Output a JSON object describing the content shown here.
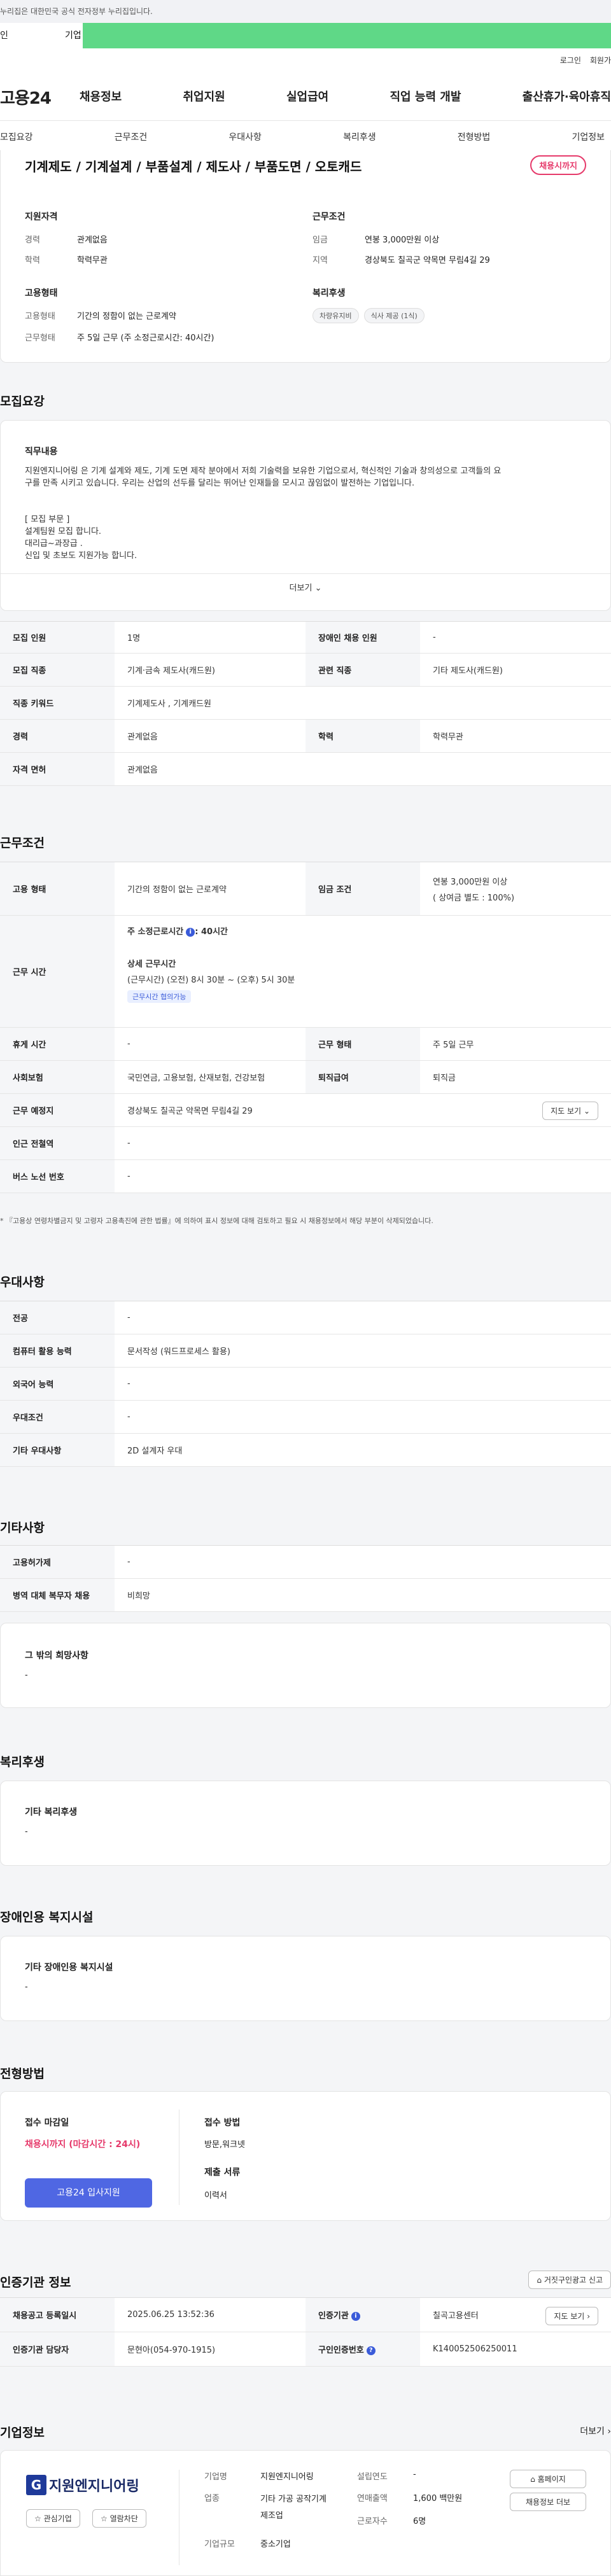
{
  "gov_note": "누리집은 대한민국 공식 전자정부 누리집입니다.",
  "top_tabs": [
    "인",
    "기업"
  ],
  "header": {
    "auth": [
      "로그인",
      "회원가"
    ],
    "logo": "고용24",
    "gnb": [
      "채용정보",
      "취업지원",
      "실업급여",
      "직업 능력 개발",
      "출산휴가·육아휴직"
    ]
  },
  "subnav": [
    "모집요강",
    "근무조건",
    "우대사항",
    "복리후생",
    "전형방법",
    "기업정보"
  ],
  "summary": {
    "title": "기계제도 / 기계설계 / 부품설계 / 제도사 / 부품도면 / 오토캐드",
    "status": "채용시까지",
    "qual_title": "지원자격",
    "qual": [
      [
        "경력",
        "관계없음"
      ],
      [
        "학력",
        "학력무관"
      ]
    ],
    "cond_title": "근무조건",
    "cond": [
      [
        "임금",
        "연봉 3,000만원 이상"
      ],
      [
        "지역",
        "경상북도 칠곡군 약목면 무림4길 29"
      ]
    ],
    "emp_title": "고용형태",
    "emp": [
      [
        "고용형태",
        "기간의 정함이 없는 근로계약"
      ],
      [
        "근무형태",
        "주 5일 근무 (주 소정근로시간: 40시간)"
      ]
    ],
    "welfare_title": "복리후생",
    "welfare_tags": [
      "차량유지비",
      "식사 제공 (1식)"
    ]
  },
  "recruit": {
    "heading": "모집요강",
    "job_title": "직무내용",
    "job_lines": [
      "지원엔지니어링 은  기계 설계와 제도, 기계 도면 제작 분야에서  저희 기술력을 보유한 기업으로서, 혁신적인 기술과 창의성으로 고객들의 요",
      "구를 만족 시키고 있습니다. 우리는 산업의 선두를 달리는 뛰어난 인재들을 모시고 끊임없이 발전하는 기업입니다.",
      "",
      "[ 모집 부문 ]",
      "설계팀원 모집 합니다.",
      "대리급~과장급 .",
      "신입 및 초보도 지원가능 합니다."
    ],
    "more": "더보기",
    "rows": [
      [
        "모집 인원",
        "1명",
        "장애인 채용 인원",
        "-"
      ],
      [
        "모집 직종",
        "기계·금속 제도사(캐드원)",
        "관련 직종",
        "기타 제도사(캐드원)"
      ],
      [
        "직종 키워드",
        "기계제도사 , 기계캐드원"
      ],
      [
        "경력",
        "관계없음",
        "학력",
        "학력무관"
      ],
      [
        "자격 면허",
        "관계없음"
      ]
    ]
  },
  "work": {
    "heading": "근무조건",
    "emp_type_label": "고용 형태",
    "emp_type": "기간의 정함이 없는 근로계약",
    "wage_label": "임금 조건",
    "wage": [
      "연봉 3,000만원 이상",
      "( 상여금 별도 : 100%)"
    ],
    "hours_label": "근무 시간",
    "hours_main": "주 소정근로시간",
    "hours_val": ": 40시간",
    "hours_detail_title": "상세 근무시간",
    "hours_detail": "(근무시간) (오전) 8시 30분 ~ (오후) 5시 30분",
    "hours_badge": "근무시간 협의가능",
    "rows": [
      [
        "휴게 시간",
        "-",
        "근무 형태",
        "주 5일 근무"
      ],
      [
        "사회보험",
        "국민연금, 고용보험, 산재보험, 건강보험",
        "퇴직급여",
        "퇴직금"
      ],
      [
        "근무 예정지",
        "경상북도 칠곡군 약목면 무림4길 29"
      ],
      [
        "인근 전철역",
        "-"
      ],
      [
        "버스 노선 번호",
        "-"
      ]
    ],
    "map_btn": "지도 보기",
    "note": "* 『고용상 연령차별금지 및 고령자 고용촉진에 관한 법률』에 의하여 표시 정보에 대해 검토하고 필요 시 채용정보에서 해당 부분이 삭제되었습니다."
  },
  "pref": {
    "heading": "우대사항",
    "rows": [
      [
        "전공",
        "-"
      ],
      [
        "컴퓨터 활용 능력",
        "문서작성 (워드프로세스 활용)"
      ],
      [
        "외국어 능력",
        "-"
      ],
      [
        "우대조건",
        "-"
      ],
      [
        "기타 우대사항",
        "2D 설계자 우대"
      ]
    ]
  },
  "etc": {
    "heading": "기타사항",
    "rows": [
      [
        "고용허가제",
        "-"
      ],
      [
        "병역 대체 복무자 채용",
        "비희망"
      ]
    ],
    "box_title": "그 밖의 희망사항",
    "box_val": "-"
  },
  "welfare": {
    "heading": "복리후생",
    "box_title": "기타 복리후생",
    "box_val": "-"
  },
  "disabled": {
    "heading": "장애인용 복지시설",
    "box_title": "기타 장애인용 복지시설",
    "box_val": "-"
  },
  "process": {
    "heading": "전형방법",
    "deadline_label": "접수 마감일",
    "deadline": "채용시까지 (마감시간 : 24시)",
    "apply_btn": "고용24 입사지원",
    "method_label": "접수 방법",
    "method": "방문,워크넷",
    "docs_label": "제출 서류",
    "docs": "이력서"
  },
  "agency": {
    "heading": "인증기관 정보",
    "report_btn": "거짓구인광고 신고",
    "rows": [
      [
        "채용공고 등록일시",
        "2025.06.25 13:52:36",
        "인증기관",
        "칠곡고용센터"
      ],
      [
        "인증기관 담당자",
        "문현아(054-970-1915)",
        "구인인증번호",
        "K140052506250011"
      ]
    ],
    "map_btn": "지도 보기"
  },
  "company": {
    "heading": "기업정보",
    "more": "더보기",
    "logo_text": "지원엔지니어링",
    "btns": [
      "관심기업",
      "열람차단"
    ],
    "info": [
      [
        "기업명",
        "지원엔지니어링"
      ],
      [
        "업종",
        "기타 가공 공작기계 제조업"
      ],
      [
        "기업규모",
        "중소기업"
      ]
    ],
    "info2": [
      [
        "설립연도",
        "-"
      ],
      [
        "연매출액",
        "1,600 백만원"
      ],
      [
        "근로자수",
        "6명"
      ]
    ],
    "right_btns": [
      "홈페이지",
      "채용정보 더보"
    ]
  }
}
